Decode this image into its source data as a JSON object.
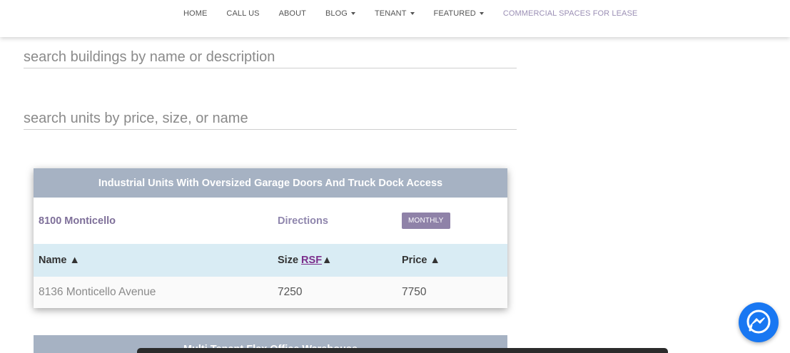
{
  "nav": {
    "items": [
      {
        "label": "HOME"
      },
      {
        "label": "CALL US"
      },
      {
        "label": "ABOUT"
      },
      {
        "label": "BLOG",
        "dropdown": true
      },
      {
        "label": "TENANT",
        "dropdown": true
      },
      {
        "label": "FEATURED",
        "dropdown": true
      },
      {
        "label": "COMMERCIAL SPACES FOR LEASE",
        "active": true
      }
    ]
  },
  "search": {
    "buildings_placeholder": "search buildings by name or description",
    "units_placeholder": "search units by price, size, or name"
  },
  "listing": {
    "header": "Industrial Units With Oversized Garage Doors And Truck Dock Access",
    "building_name": "8100 Monticello",
    "directions_label": "Directions",
    "monthly_label": "MONTHLY",
    "columns": {
      "name": "Name ▲",
      "size_prefix": "Size ",
      "size_unit": "RSF",
      "size_sort": "▲",
      "price": "Price ▲"
    },
    "rows": [
      {
        "name": "8136 Monticello Avenue",
        "size": "7250",
        "price": "7750"
      }
    ]
  },
  "listing2": {
    "header": "Multi Tenant Flex Office Warehouse"
  },
  "icons": {
    "messenger": "messenger-icon"
  },
  "colors": {
    "card_header": "#a6b2c3",
    "accent_purple": "#8f82a8",
    "table_header_bg": "#d9ecf4",
    "messenger_blue": "#1877f2"
  }
}
